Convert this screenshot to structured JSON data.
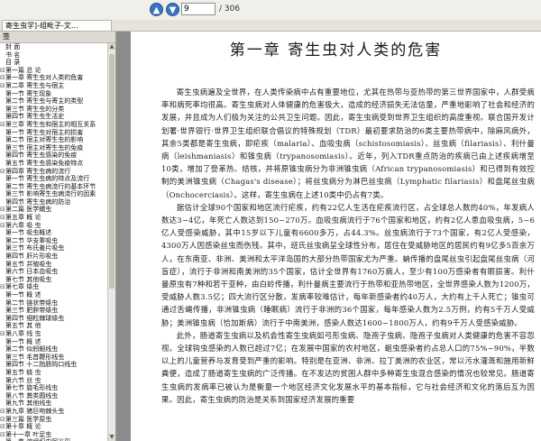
{
  "toolbar": {
    "prev_icon": "▲",
    "next_icon": "▼",
    "page_value": "9",
    "page_total": "/ 306"
  },
  "tab": {
    "label": "寄生虫学]-组毗子-文..."
  },
  "sidebar": {
    "header": "签",
    "items": [
      {
        "t": "",
        "label": "封  面"
      },
      {
        "t": "",
        "label": "书  名"
      },
      {
        "t": "",
        "label": "目  录"
      },
      {
        "t": "⊟",
        "label": "第一篇  总  论"
      },
      {
        "t": "⊟",
        "label": "第一章  寄生虫对人类的危害"
      },
      {
        "t": "⊟",
        "label": "第二章  寄生虫与宿主"
      },
      {
        "t": "",
        "label": "第一节  寄生现象"
      },
      {
        "t": "",
        "label": "第二节  寄生虫与寄主的类型"
      },
      {
        "t": "",
        "label": "第三节  寄生虫的分类"
      },
      {
        "t": "",
        "label": "第四节  寄生虫生活史"
      },
      {
        "t": "⊟",
        "label": "第三章  寄生虫和宿主的相互关系"
      },
      {
        "t": "",
        "label": "第一节  寄生虫对宿主的损害"
      },
      {
        "t": "",
        "label": "第二节  宿主对寄生虫的影响"
      },
      {
        "t": "",
        "label": "第三节  宿主对寄生虫的免疫"
      },
      {
        "t": "",
        "label": "第四节  寄生虫感染的免疫"
      },
      {
        "t": "",
        "label": "第五节  寄生虫感染免疫特点"
      },
      {
        "t": "⊟",
        "label": "第四章  寄生虫病的流行"
      },
      {
        "t": "",
        "label": "第一节  寄生虫病的特点及流行"
      },
      {
        "t": "",
        "label": "第二节  寄生虫病流行的基本环节"
      },
      {
        "t": "",
        "label": "第三节  影响寄生虫病流行的因素"
      },
      {
        "t": "",
        "label": "第四节  寄生虫病的防治"
      },
      {
        "t": "⊟",
        "label": "第二篇  医学蠕虫"
      },
      {
        "t": "⊟",
        "label": "第五章  概  论"
      },
      {
        "t": "⊟",
        "label": "第六章  吸  虫"
      },
      {
        "t": "",
        "label": "第一节  吸虫概述"
      },
      {
        "t": "",
        "label": "第二节  华支睾吸虫"
      },
      {
        "t": "",
        "label": "第三节  布氏姜片吸虫"
      },
      {
        "t": "",
        "label": "第四节  肝片形吸虫"
      },
      {
        "t": "",
        "label": "第五节  并殖吸虫"
      },
      {
        "t": "",
        "label": "第六节  日本血吸虫"
      },
      {
        "t": "",
        "label": "第七节  其他吸虫"
      },
      {
        "t": "⊟",
        "label": "第七章  绦虫"
      },
      {
        "t": "",
        "label": "第一节  概  述"
      },
      {
        "t": "",
        "label": "第二节  链状带绦虫"
      },
      {
        "t": "",
        "label": "第三节  肥胖带绦虫"
      },
      {
        "t": "",
        "label": "第四节  细粒棘球绦虫"
      },
      {
        "t": "",
        "label": "第五节  其  他"
      },
      {
        "t": "⊟",
        "label": "第八章  线  虫"
      },
      {
        "t": "",
        "label": "第一节  概  述"
      },
      {
        "t": "",
        "label": "第二节  似蚓蛔线虫"
      },
      {
        "t": "",
        "label": "第三节  毛首鞭形线虫"
      },
      {
        "t": "",
        "label": "第四节  十二指肠钩口线虫"
      },
      {
        "t": "",
        "label": "第五节  蛲  虫"
      },
      {
        "t": "",
        "label": "第六节  丝  虫"
      },
      {
        "t": "",
        "label": "第七节  旋毛形线虫"
      },
      {
        "t": "",
        "label": "第八节  粪类圆线虫"
      },
      {
        "t": "",
        "label": "第九节  其他线虫"
      },
      {
        "t": "⊟",
        "label": "第九章  猪巨吻棘头虫"
      },
      {
        "t": "⊟",
        "label": "第三篇  医学原虫"
      },
      {
        "t": "⊟",
        "label": "第十章  概  论"
      },
      {
        "t": "⊟",
        "label": "第十一章  叶足虫"
      },
      {
        "t": "",
        "label": "第一节  溶组织内阿米巴"
      },
      {
        "t": "",
        "label": "第二节  其他人体非致病阿米巴"
      },
      {
        "t": "",
        "label": "第三节  致病性自生生活阿米巴"
      }
    ]
  },
  "page": {
    "title": "第一章    寄生虫对人类的危害",
    "paragraphs": [
      "寄生虫病遍及全世界，在人类传染病中占有重要地位，尤其在热带与亚热带的第三世界国家中，人群受病率和病死率均很高。寄生虫病对人体健康的危害极大，造成的经济损失无法估量，严重地影响了社会和经济的发展，并且成为人们极为关注的公共卫生问题。因此，寄生虫病受到世界卫生组织的高度重视。联合国开发计划署·世界银行·世界卫生组织联合倡议的特殊规划（TDR）最初要求防治的6类主要热带病中，除麻风病外，其余5类都是寄生虫病，即疟疾（malaria）、血吸虫病（schistosomiasis）、丝虫病（filariasis）、利什曼病（leishmaniasis）和锥虫病（trypanosomiasis）。近年，列入TDR重点防治的疾病已由上述疾病增至10类，增加了登革热、结核，并将原锥虫病分为非洲锥虫病（African trypanosomiasis）和已得到有效控制的美洲锥虫病（Chagas's disease）；将丝虫病分为淋巴丝虫病（Lymphatic filariasis）和盘尾丝虫病（Onchocerciasis）。这样，寄生虫病在上述10类中仍占有7类。",
      "据估计全球90个国家和地区流行疟疾，约有22亿人生活在疟疾流行区，占全球总人数的40%，年发病人数达3~4亿，年死亡人数达到150~270万。血吸虫病流行于76个国家和地区，约有2亿人患血吸虫病，5~6亿人受感染威胁，其中15岁以下儿童有6600多万，占44.3%。丝虫病流行于73个国家，有2亿人受感染，4300万人因感染丝虫而伤残。其中，班氏丝虫病呈全球性分布，居住在受威胁地区的居民约有9亿多5百余万人，在东南亚、非洲、美洲和太平洋岛国的大部分热带国家尤为严重。蚋传播的盘尾丝虫引起盘尾丝虫病（河盲症），流行于非洲和南美洲的35个国家，估计全世界有1760万病人，至少有100万感染者有眼损害。利什曼原虫有7种和若干亚种，由白蛉传播，利什曼病主要流行于热带和亚热带地区，全世界感染人数为1200万，受威胁人数3.5亿；四大流行区分散，发病率较难估计，每年新感染者约40万人，大约有上千人死亡；锥虫可通过舌蝇传播，非洲锥虫病（睡眠病）流行于非洲的36个国家，每年感染人数为2.5万例，约有5千万人受威胁；美洲锥虫病（恰加斯病）流行于中南美洲，感染人数达1600~1800万人，约有9千万人受感染威胁。",
      "此外，肠道寄生虫病以及机会性寄生虫病如弓形虫病、隐孢子虫病、隐孢子虫病对人类健康的危害不容忽视。全球钩虫感染的人数已超过7亿；在发展中国家的农村地区，蛔虫感染者约占总人口的75%~90%，半数以上的儿童营养与发育受到严重的影响。特别是在亚洲、非洲、拉丁美洲的农业区，常以污水灌溉和施用新鲜粪便，造成了肠道寄生虫病的广泛传播。在不发达的贫困人群中多种寄生虫混合感染的情况也较常见。肠道寄生虫病的发病率已被认为是衡量一个地区经济文化发展水平的基本指标，它与社会经济和文化的落后互为因果。因此，寄生虫病的防治是关系到国家经济发展的重要"
    ]
  }
}
